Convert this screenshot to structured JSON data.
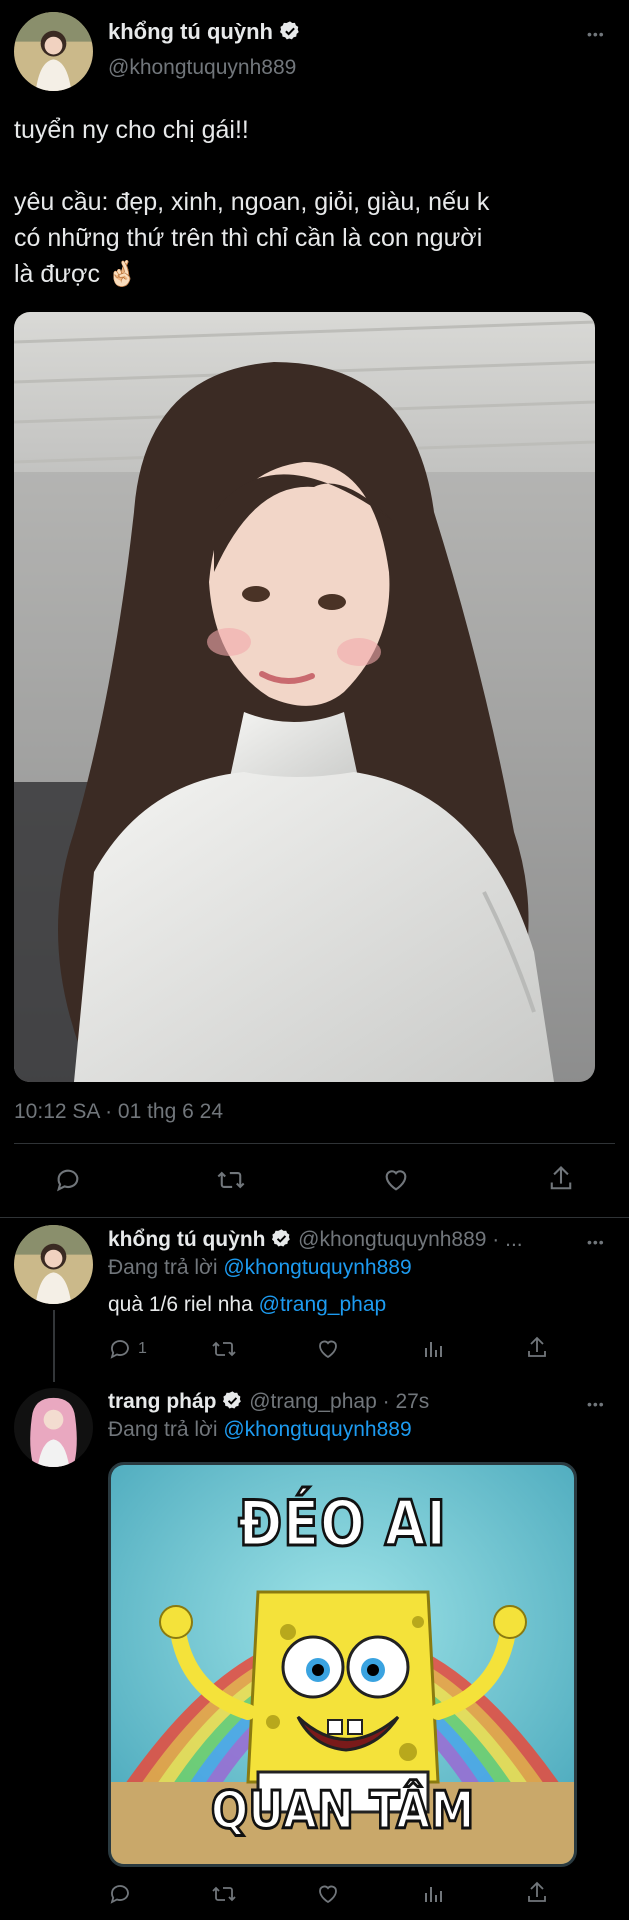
{
  "main_tweet": {
    "display_name": "khổng tú quỳnh",
    "handle": "@khongtuquynh889",
    "more": "•••",
    "text_line1": "tuyển ny cho chị gái!!",
    "text_line2": "yêu cầu: đẹp, xinh, ngoan, giỏi, giàu, nếu k",
    "text_line3": "có những thứ trên thì chỉ cần là con người",
    "text_line4": "là được",
    "emoji": "🤞🏻",
    "timestamp": "10:12 SA · 01 thg 6 24",
    "actions": [
      "reply-icon",
      "retweet-icon",
      "like-icon",
      "share-icon"
    ]
  },
  "reply1": {
    "display_name": "khổng tú quỳnh",
    "handle": "@khongtuquynh889 · ...",
    "more": "•••",
    "replying_prefix": "Đang trả lời",
    "replying_to": "@khongtuquynh889",
    "text": "quà 1/6 riel nha",
    "mention": "@trang_phap",
    "reply_count": "1"
  },
  "reply2": {
    "display_name": "trang pháp",
    "handle": "@trang_phap",
    "time": "· 27s",
    "more": "•••",
    "replying_prefix": "Đang trả lời",
    "replying_to": "@khongtuquynh889",
    "meme_top": "ĐÉO AI",
    "meme_bottom": "QUAN TÂM"
  },
  "colors": {
    "background": "#000000",
    "text": "#e7e9ea",
    "muted": "#71767b",
    "link": "#1d9bf0",
    "divider": "#2f3336"
  }
}
